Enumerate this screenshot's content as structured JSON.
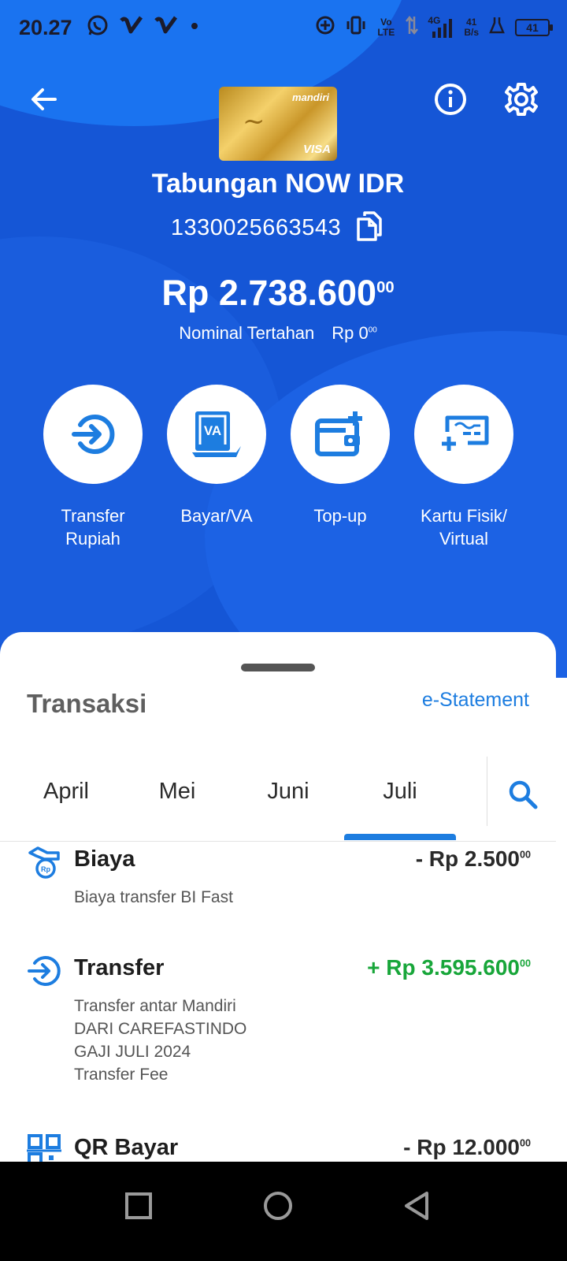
{
  "status_bar": {
    "time": "20.27",
    "network_label": "4G",
    "volte_label": "Vo LTE",
    "speed_value": "41",
    "speed_unit": "B/s",
    "battery": "41"
  },
  "header": {
    "card_brand": "mandiri",
    "card_network": "VISA"
  },
  "account": {
    "name": "Tabungan NOW IDR",
    "number": "1330025663543",
    "balance_main": "Rp 2.738.600",
    "balance_cents": "00",
    "held_label": "Nominal Tertahan",
    "held_main": "Rp 0",
    "held_cents": "00"
  },
  "actions": [
    {
      "line1": "Transfer",
      "line2": "Rupiah",
      "icon": "transfer-icon"
    },
    {
      "line1": "Bayar/VA",
      "line2": "",
      "icon": "va-icon"
    },
    {
      "line1": "Top-up",
      "line2": "",
      "icon": "wallet-topup-icon"
    },
    {
      "line1": "Kartu Fisik/",
      "line2": "Virtual",
      "icon": "card-icon"
    }
  ],
  "transactions_section": {
    "title": "Transaksi",
    "estatement_label": "e-Statement",
    "tabs": [
      "April",
      "Mei",
      "Juni",
      "Juli"
    ],
    "active_tab": "Juli"
  },
  "transactions": [
    {
      "icon": "fee-icon",
      "title": "Biaya",
      "amount_main": "- Rp 2.500",
      "amount_cents": "00",
      "direction": "out",
      "desc": [
        "Biaya transfer BI Fast"
      ]
    },
    {
      "icon": "transfer-icon",
      "title": "Transfer",
      "amount_main": "+ Rp 3.595.600",
      "amount_cents": "00",
      "direction": "in",
      "desc": [
        "Transfer antar Mandiri",
        "DARI CAREFASTINDO",
        "GAJI JULI 2024",
        "Transfer Fee"
      ]
    },
    {
      "icon": "qr-icon",
      "title": "QR Bayar",
      "amount_main": "- Rp 12.000",
      "amount_cents": "00",
      "direction": "out",
      "desc": []
    }
  ],
  "colors": {
    "primary_blue": "#1556d6",
    "accent_blue": "#1d7de0",
    "positive_green": "#18a63a"
  }
}
